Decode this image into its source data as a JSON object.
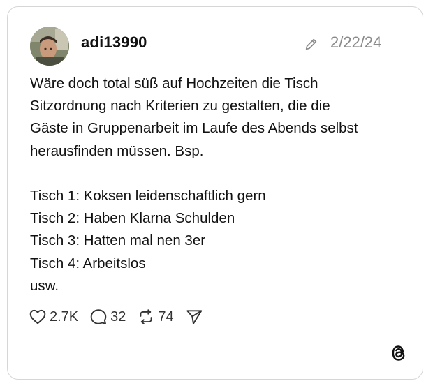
{
  "post": {
    "username": "adi13990",
    "date": "2/22/24",
    "body_lines": [
      "Wäre doch total süß auf Hochzeiten die Tisch",
      "Sitzordnung nach Kriterien zu gestalten, die die",
      "Gäste in Gruppenarbeit im Laufe des Abends selbst",
      "herausfinden müssen. Bsp.",
      "",
      "Tisch 1: Koksen leidenschaftlich gern",
      "Tisch 2: Haben Klarna Schulden",
      "Tisch 3: Hatten mal nen 3er",
      "Tisch 4: Arbeitslos",
      "usw."
    ]
  },
  "actions": {
    "likes": "2.7K",
    "replies": "32",
    "reposts": "74"
  },
  "icons": {
    "avatar": "profile-photo",
    "edit": "pencil-icon",
    "like": "heart-icon",
    "reply": "comment-bubble-icon",
    "repost": "repost-icon",
    "share": "send-icon",
    "brand": "threads-logo"
  },
  "colors": {
    "text": "#111111",
    "muted": "#8a8a8a",
    "border": "#d6d6d6"
  }
}
